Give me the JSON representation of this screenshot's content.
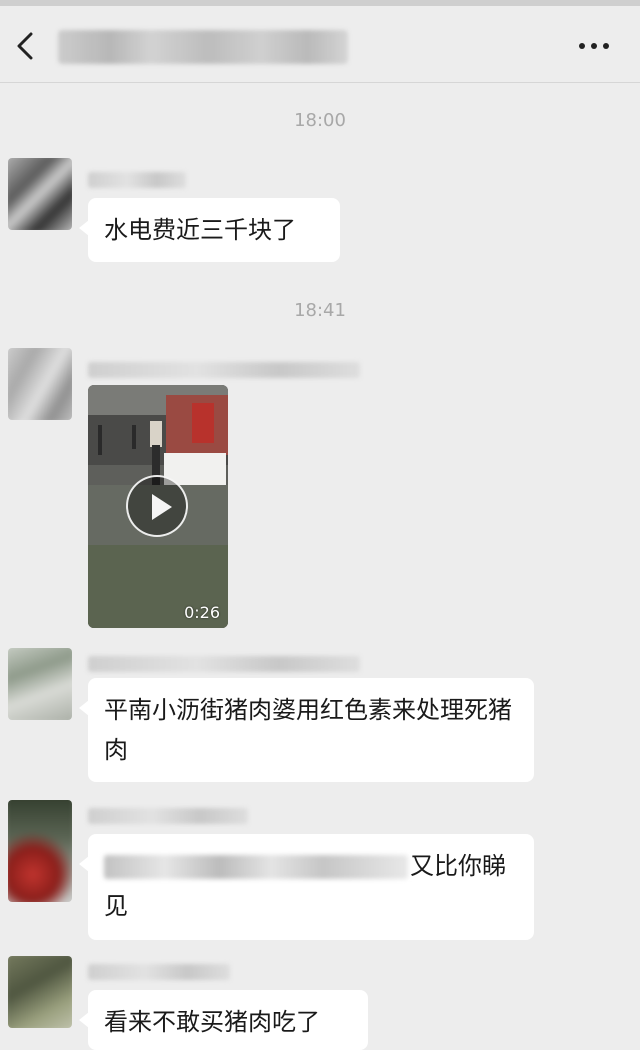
{
  "header": {
    "title": "",
    "back_icon": "chevron-left-icon",
    "more_icon": "more-dots-icon"
  },
  "messages": {
    "ts1": "18:00",
    "m1_text": "水电费近三千块了",
    "ts2": "18:41",
    "video_duration": "0:26",
    "m3_text": "平南小沥街猪肉婆用红色素来处理死猪肉",
    "m4_text_visible": "又比你睇见",
    "m5_text": "看来不敢买猪肉吃了"
  },
  "colors": {
    "background": "#ededed",
    "bubble": "#ffffff",
    "timestamp": "#a8a8a8",
    "text": "#1a1a1a"
  }
}
